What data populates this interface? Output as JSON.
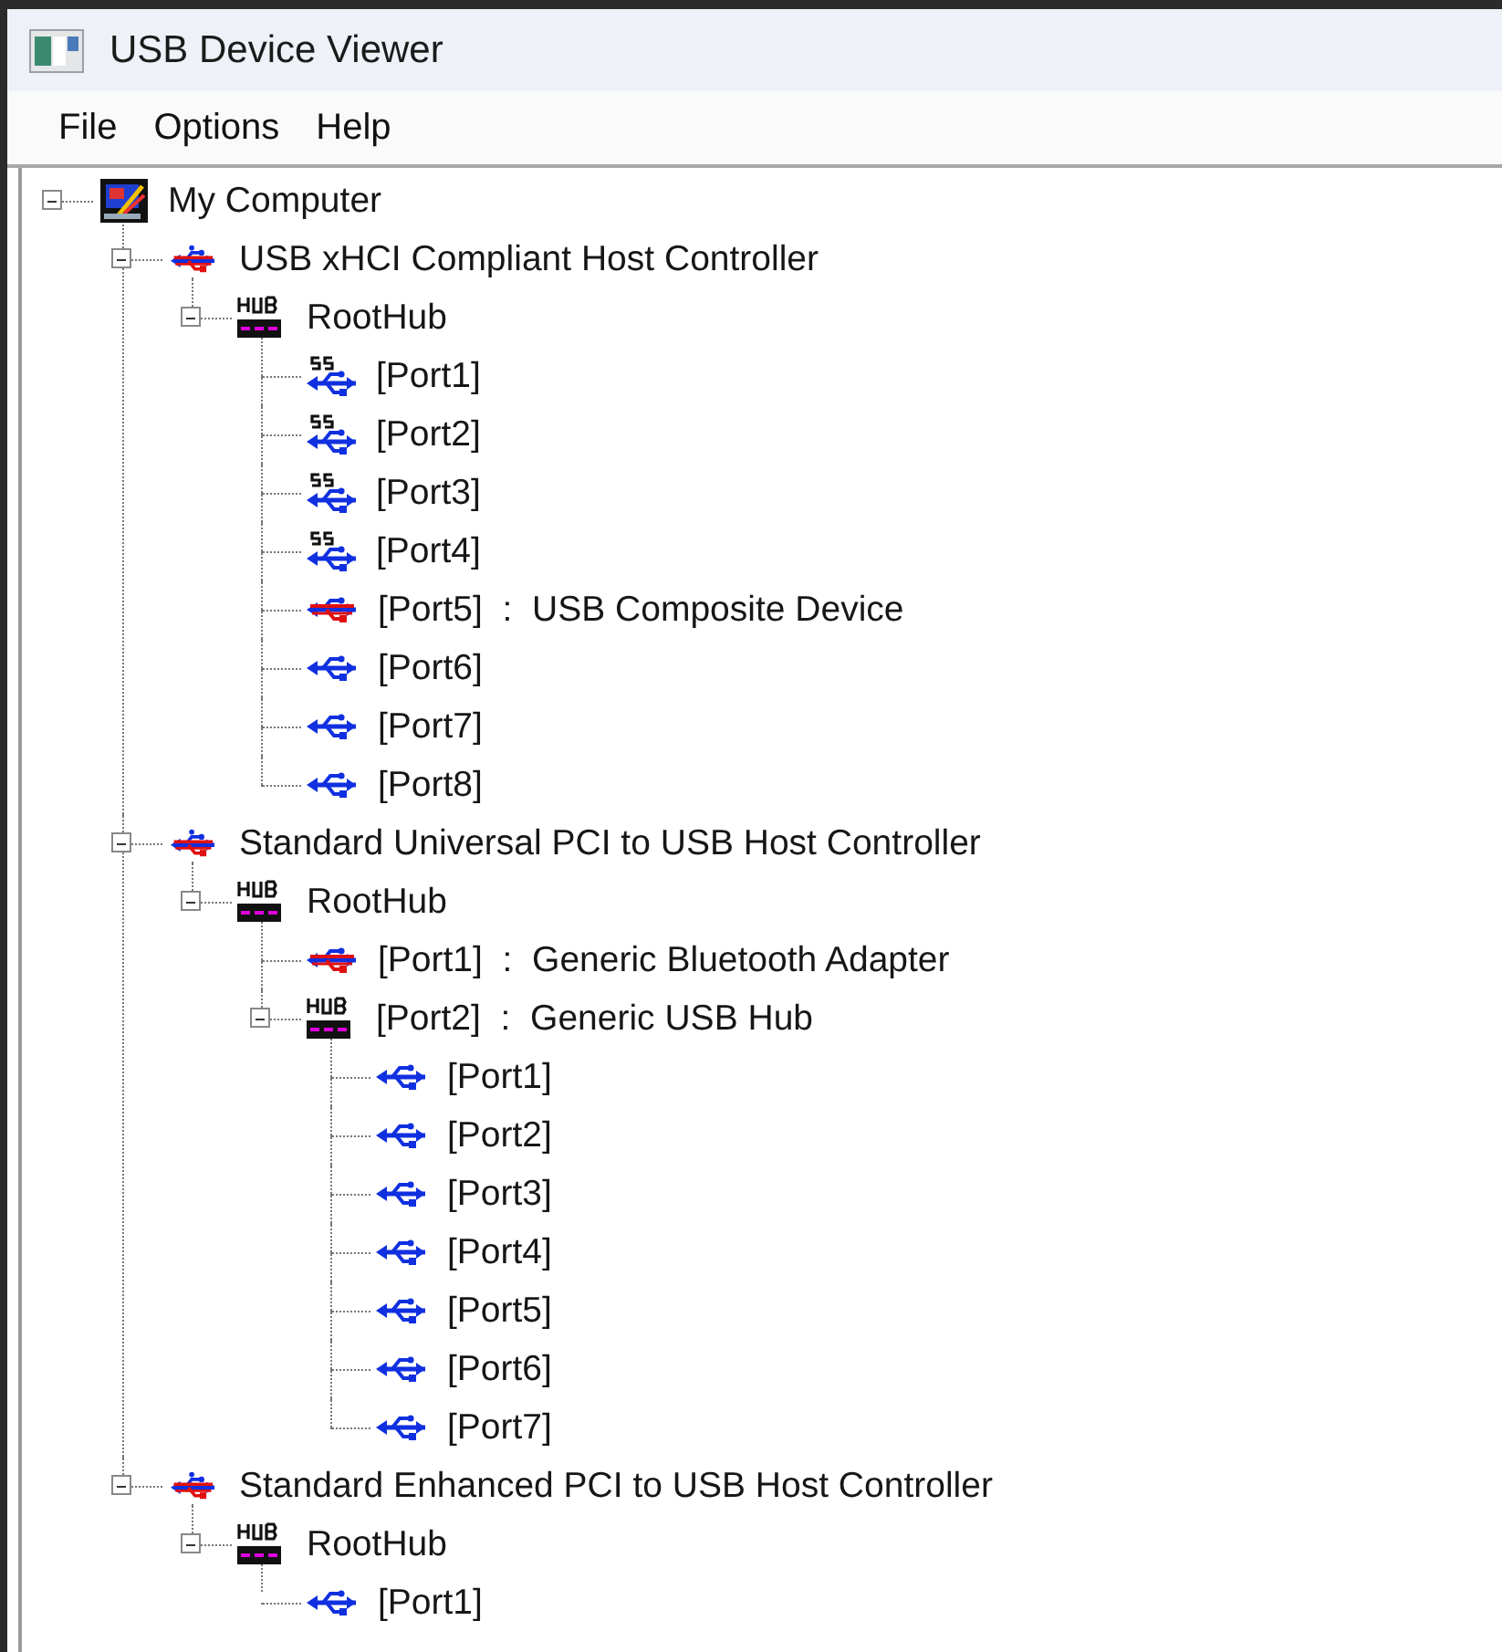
{
  "window": {
    "title": "USB Device Viewer"
  },
  "menu": [
    "File",
    "Options",
    "Help"
  ],
  "tree": [
    {
      "kind": "computer",
      "label": "My Computer",
      "expanded": true,
      "children": [
        {
          "kind": "controller",
          "label": "USB xHCI Compliant Host Controller",
          "expanded": true,
          "children": [
            {
              "kind": "hub",
              "label": "RootHub",
              "expanded": true,
              "children": [
                {
                  "kind": "ss_port",
                  "label": "[Port1]"
                },
                {
                  "kind": "ss_port",
                  "label": "[Port2]"
                },
                {
                  "kind": "ss_port",
                  "label": "[Port3]"
                },
                {
                  "kind": "ss_port",
                  "label": "[Port4]"
                },
                {
                  "kind": "device",
                  "label": "[Port5]  :  USB Composite Device"
                },
                {
                  "kind": "port",
                  "label": "[Port6]"
                },
                {
                  "kind": "port",
                  "label": "[Port7]"
                },
                {
                  "kind": "port",
                  "label": "[Port8]"
                }
              ]
            }
          ]
        },
        {
          "kind": "controller",
          "label": "Standard Universal PCI to USB Host Controller",
          "expanded": true,
          "children": [
            {
              "kind": "hub",
              "label": "RootHub",
              "expanded": true,
              "children": [
                {
                  "kind": "device",
                  "label": "[Port1]  :  Generic Bluetooth Adapter"
                },
                {
                  "kind": "hub",
                  "label": "[Port2]  :  Generic USB Hub",
                  "expanded": true,
                  "children": [
                    {
                      "kind": "port",
                      "label": "[Port1]"
                    },
                    {
                      "kind": "port",
                      "label": "[Port2]"
                    },
                    {
                      "kind": "port",
                      "label": "[Port3]"
                    },
                    {
                      "kind": "port",
                      "label": "[Port4]"
                    },
                    {
                      "kind": "port",
                      "label": "[Port5]"
                    },
                    {
                      "kind": "port",
                      "label": "[Port6]"
                    },
                    {
                      "kind": "port",
                      "label": "[Port7]"
                    }
                  ]
                }
              ]
            }
          ]
        },
        {
          "kind": "controller",
          "label": "Standard Enhanced PCI to USB Host Controller",
          "expanded": true,
          "children": [
            {
              "kind": "hub",
              "label": "RootHub",
              "expanded": true,
              "children": [
                {
                  "kind": "port",
                  "label": "[Port1]"
                }
              ]
            }
          ]
        }
      ]
    }
  ]
}
